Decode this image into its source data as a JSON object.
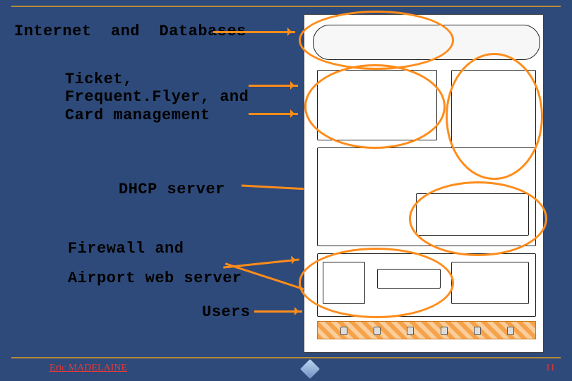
{
  "labels": {
    "internet_db": "Internet  and  Databases",
    "ticket_block": "Ticket,\nFrequent.Flyer, and\nCard management",
    "dhcp": "DHCP server",
    "firewall": "Firewall and",
    "airport_web": "Airport web server",
    "users": "Users"
  },
  "footer": {
    "author": "Eric MADELAINE",
    "page_number": "11"
  },
  "diagram": {
    "description": "Miniature system architecture diagram with orange highlight ellipses marking: Internet/Databases, Ticket/FrequentFlyer/Card management, DHCP server, Firewall + Airport web server, and Users tier.",
    "highlight_targets": [
      "internet-databases",
      "ticket-frequentflyer-card",
      "dhcp-server",
      "firewall-airport-web-server",
      "users"
    ]
  }
}
